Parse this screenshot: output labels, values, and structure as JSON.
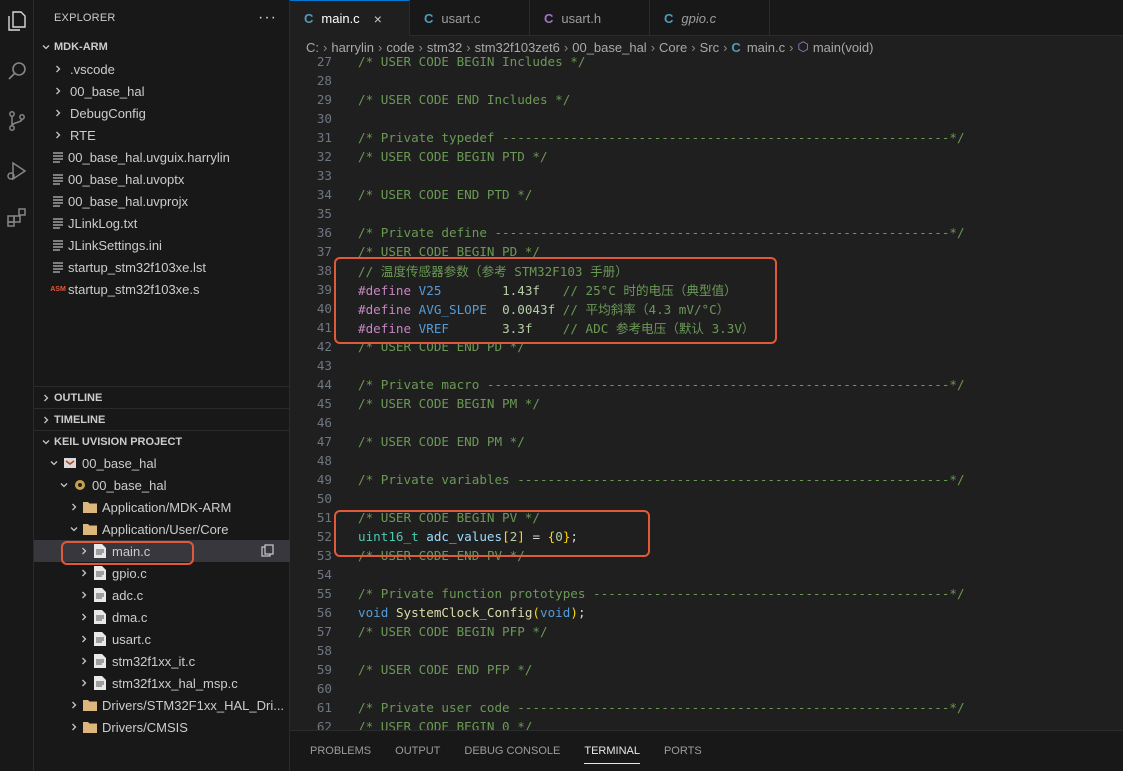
{
  "explorer": {
    "title": "EXPLORER",
    "more": "···",
    "root": "MDK-ARM",
    "items": [
      {
        "label": ".vscode",
        "kind": "folder"
      },
      {
        "label": "00_base_hal",
        "kind": "folder"
      },
      {
        "label": "DebugConfig",
        "kind": "folder"
      },
      {
        "label": "RTE",
        "kind": "folder"
      },
      {
        "label": "00_base_hal.uvguix.harrylin",
        "kind": "file"
      },
      {
        "label": "00_base_hal.uvoptx",
        "kind": "file"
      },
      {
        "label": "00_base_hal.uvprojx",
        "kind": "file"
      },
      {
        "label": "JLinkLog.txt",
        "kind": "file"
      },
      {
        "label": "JLinkSettings.ini",
        "kind": "file"
      },
      {
        "label": "startup_stm32f103xe.lst",
        "kind": "file"
      },
      {
        "label": "startup_stm32f103xe.s",
        "kind": "asm",
        "badge": "ASM"
      }
    ]
  },
  "outline": {
    "title": "OUTLINE"
  },
  "timeline": {
    "title": "TIMELINE"
  },
  "keil": {
    "title": "KEIL UVISION PROJECT",
    "project": "00_base_hal",
    "target": "00_base_hal",
    "groups": [
      {
        "label": "Application/MDK-ARM"
      },
      {
        "label": "Application/User/Core"
      }
    ],
    "files": [
      "main.c",
      "gpio.c",
      "adc.c",
      "dma.c",
      "usart.c",
      "stm32f1xx_it.c",
      "stm32f1xx_hal_msp.c"
    ],
    "drivers": [
      "Drivers/STM32F1xx_HAL_Dri...",
      "Drivers/CMSIS"
    ]
  },
  "tabs": [
    {
      "icon": "C",
      "label": "main.c",
      "close": "×",
      "color": "#519aba"
    },
    {
      "icon": "C",
      "label": "usart.c",
      "color": "#519aba"
    },
    {
      "icon": "C",
      "label": "usart.h",
      "color": "#a074c4"
    },
    {
      "icon": "C",
      "label": "gpio.c",
      "color": "#519aba"
    }
  ],
  "breadcrumb": {
    "parts": [
      "C:",
      "harrylin",
      "code",
      "stm32",
      "stm32f103zet6",
      "00_base_hal",
      "Core",
      "Src"
    ],
    "file_icon": "C",
    "file": "main.c",
    "symbol": "main(void)"
  },
  "code": {
    "lines": [
      {
        "n": "27",
        "t": "/* USER CODE BEGIN Includes */"
      },
      {
        "n": "28",
        "t": ""
      },
      {
        "n": "29",
        "t": "/* USER CODE END Includes */"
      },
      {
        "n": "30",
        "t": ""
      },
      {
        "n": "31",
        "t": "/* Private typedef -----------------------------------------------------------*/"
      },
      {
        "n": "32",
        "t": "/* USER CODE BEGIN PTD */"
      },
      {
        "n": "33",
        "t": ""
      },
      {
        "n": "34",
        "t": "/* USER CODE END PTD */"
      },
      {
        "n": "35",
        "t": ""
      },
      {
        "n": "36",
        "t": "/* Private define ------------------------------------------------------------*/"
      },
      {
        "n": "37",
        "t": "/* USER CODE BEGIN PD */"
      },
      {
        "n": "38",
        "t": "// 温度传感器参数（参考 STM32F103 手册）"
      },
      {
        "n": "39",
        "t": "#define V25        1.43f   // 25°C 时的电压（典型值）"
      },
      {
        "n": "40",
        "t": "#define AVG_SLOPE  0.0043f // 平均斜率（4.3 mV/°C）"
      },
      {
        "n": "41",
        "t": "#define VREF       3.3f    // ADC 参考电压（默认 3.3V）"
      },
      {
        "n": "42",
        "t": "/* USER CODE END PD */"
      },
      {
        "n": "43",
        "t": ""
      },
      {
        "n": "44",
        "t": "/* Private macro -------------------------------------------------------------*/"
      },
      {
        "n": "45",
        "t": "/* USER CODE BEGIN PM */"
      },
      {
        "n": "46",
        "t": ""
      },
      {
        "n": "47",
        "t": "/* USER CODE END PM */"
      },
      {
        "n": "48",
        "t": ""
      },
      {
        "n": "49",
        "t": "/* Private variables ---------------------------------------------------------*/"
      },
      {
        "n": "50",
        "t": ""
      },
      {
        "n": "51",
        "t": "/* USER CODE BEGIN PV */"
      },
      {
        "n": "52",
        "t": "uint16_t adc_values[2] = {0};"
      },
      {
        "n": "53",
        "t": "/* USER CODE END PV */"
      },
      {
        "n": "54",
        "t": ""
      },
      {
        "n": "55",
        "t": "/* Private function prototypes -----------------------------------------------*/"
      },
      {
        "n": "56",
        "t": "void SystemClock_Config(void);"
      },
      {
        "n": "57",
        "t": "/* USER CODE BEGIN PFP */"
      },
      {
        "n": "58",
        "t": ""
      },
      {
        "n": "59",
        "t": "/* USER CODE END PFP */"
      },
      {
        "n": "60",
        "t": ""
      },
      {
        "n": "61",
        "t": "/* Private user code ---------------------------------------------------------*/"
      },
      {
        "n": "62",
        "t": "/* USER CODE BEGIN 0 */"
      }
    ]
  },
  "panel": {
    "tabs": [
      "PROBLEMS",
      "OUTPUT",
      "DEBUG CONSOLE",
      "TERMINAL",
      "PORTS"
    ],
    "active": "TERMINAL"
  },
  "colors": {
    "accent": "#0078d4",
    "highlight_box": "#e05a3a",
    "folder": "#dcb67a"
  }
}
